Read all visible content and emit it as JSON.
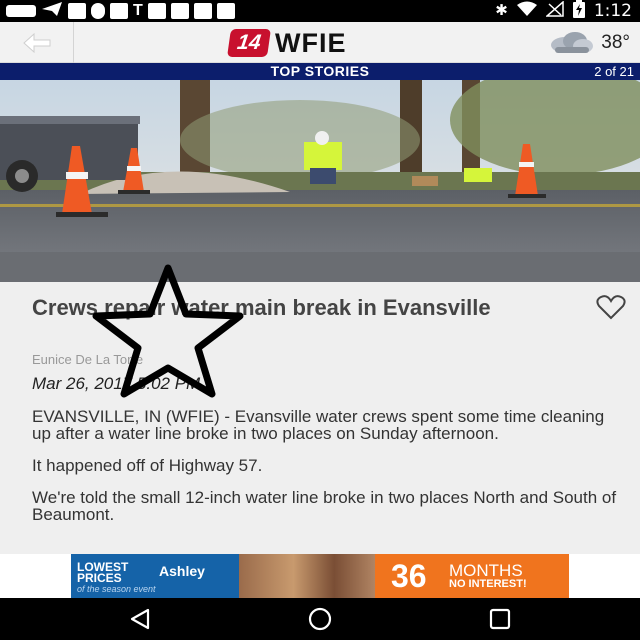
{
  "status_bar": {
    "time": "1:12",
    "left_icons": [
      "chat-icon",
      "send-icon",
      "facebook-icon",
      "thermometer-icon",
      "message-icon",
      "t-icon",
      "square-icon",
      "square-icon",
      "square-icon",
      "square-icon"
    ],
    "left_glyph_t": "T",
    "right_icons": [
      "bluetooth-icon",
      "wifi-icon",
      "no-signal-icon",
      "battery-charging-icon"
    ],
    "bluetooth_glyph": "✱"
  },
  "app_bar": {
    "brand_badge": "14",
    "brand_name": "WFIE",
    "temperature": "38°",
    "back_icon": "back-arrow-icon",
    "weather_icon": "cloud-icon"
  },
  "stories_bar": {
    "title": "TOP STORIES",
    "count": "2 of 21",
    "background": "#0c1e6c"
  },
  "article": {
    "headline": "Crews repair water main break in Evansville",
    "author": "Eunice De La Torre",
    "date": "Mar 26, 2017 5:02 PM",
    "paragraphs": [
      "EVANSVILLE, IN (WFIE) - Evansville water crews spent some time cleaning up after a water line broke in two places on Sunday afternoon.",
      "It happened off of Highway 57.",
      "We're told the small 12-inch water line broke in two places North and South of Beaumont."
    ],
    "favorite_icon": "heart-outline-icon",
    "overlay_icon": "star-outline-icon"
  },
  "ad": {
    "left_line1": "LOWEST",
    "left_line2": "PRICES",
    "left_line3": "of the season event",
    "brand": "Ashley",
    "big_number": "36",
    "months": "MONTHS",
    "interest": "NO INTEREST!",
    "accent": "#f0741e",
    "left_color": "#1563a8"
  },
  "nav_bar": {
    "back_icon": "nav-back-icon",
    "home_icon": "nav-home-icon",
    "recents_icon": "nav-recents-icon"
  }
}
